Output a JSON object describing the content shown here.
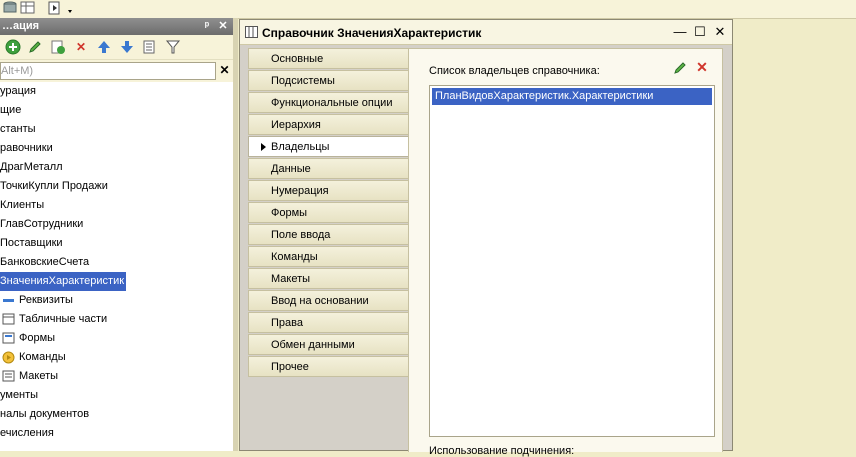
{
  "left_panel": {
    "title": "…ация",
    "search_placeholder": "Alt+M)",
    "tree": [
      {
        "label": "урация",
        "indent": 0
      },
      {
        "label": "щие",
        "indent": 0
      },
      {
        "label": "станты",
        "indent": 0
      },
      {
        "label": "равочники",
        "indent": 0
      },
      {
        "label": "ДрагМеталл",
        "indent": 0
      },
      {
        "label": "ТочкиКупли Продажи",
        "indent": 0
      },
      {
        "label": "Клиенты",
        "indent": 0
      },
      {
        "label": "ГлавСотрудники",
        "indent": 0
      },
      {
        "label": "Поставщики",
        "indent": 0
      },
      {
        "label": "БанковскиеСчета",
        "indent": 0
      },
      {
        "label": "ЗначенияХарактеристик",
        "indent": 0,
        "selected": true
      },
      {
        "label": "Реквизиты",
        "indent": 1,
        "icon": "attributes-icon"
      },
      {
        "label": "Табличные части",
        "indent": 1,
        "icon": "table-icon"
      },
      {
        "label": "Формы",
        "indent": 1,
        "icon": "form-icon"
      },
      {
        "label": "Команды",
        "indent": 1,
        "icon": "command-icon"
      },
      {
        "label": "Макеты",
        "indent": 1,
        "icon": "layout-icon"
      },
      {
        "label": "ументы",
        "indent": 0
      },
      {
        "label": "налы документов",
        "indent": 0
      },
      {
        "label": "ечисления",
        "indent": 0
      }
    ]
  },
  "editor": {
    "title": "Справочник ЗначенияХарактеристик",
    "tabs": [
      {
        "label": "Основные"
      },
      {
        "label": "Подсистемы"
      },
      {
        "label": "Функциональные опции"
      },
      {
        "label": "Иерархия"
      },
      {
        "label": "Владельцы",
        "active": true
      },
      {
        "label": "Данные"
      },
      {
        "label": "Нумерация"
      },
      {
        "label": "Формы"
      },
      {
        "label": "Поле ввода"
      },
      {
        "label": "Команды"
      },
      {
        "label": "Макеты"
      },
      {
        "label": "Ввод на основании"
      },
      {
        "label": "Права"
      },
      {
        "label": "Обмен данными"
      },
      {
        "label": "Прочее"
      }
    ],
    "owners_label": "Список владельцев справочника:",
    "owners": [
      "ПланВидовХарактеристик.Характеристики"
    ],
    "usage_label": "Использование подчинения:"
  },
  "colors": {
    "selection": "#3b63c4",
    "background": "#f0ecc8"
  }
}
